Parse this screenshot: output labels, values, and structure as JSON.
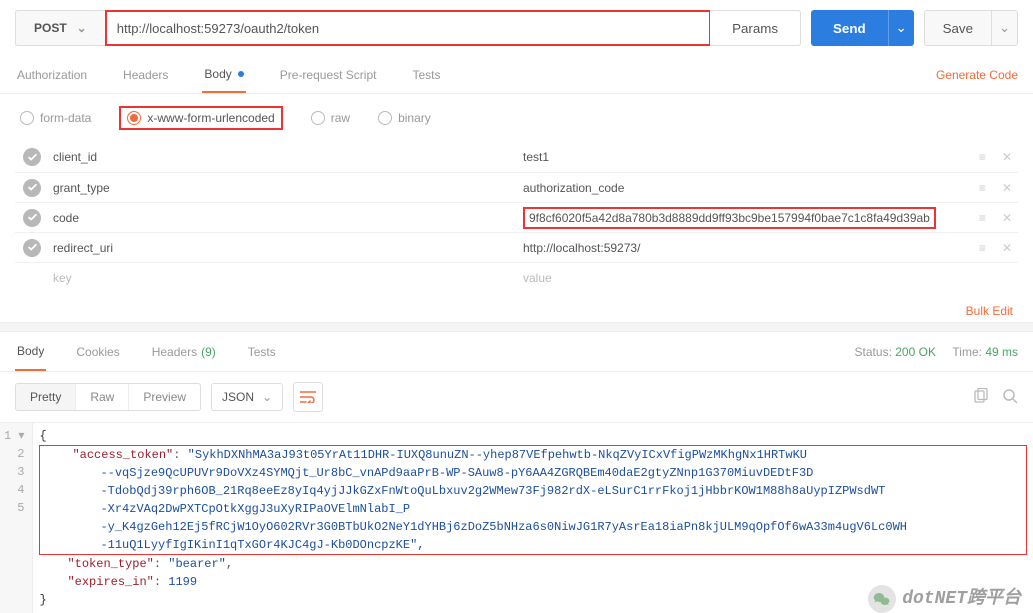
{
  "request": {
    "method": "POST",
    "url": "http://localhost:59273/oauth2/token",
    "params_btn": "Params",
    "send": "Send",
    "save": "Save"
  },
  "tabs": {
    "authorization": "Authorization",
    "headers": "Headers",
    "body": "Body",
    "prerequest": "Pre-request Script",
    "tests": "Tests",
    "generate_code": "Generate Code"
  },
  "body_types": {
    "formdata": "form-data",
    "urlencoded": "x-www-form-urlencoded",
    "raw": "raw",
    "binary": "binary"
  },
  "form": {
    "rows": [
      {
        "key": "client_id",
        "value": "test1",
        "boxed": false
      },
      {
        "key": "grant_type",
        "value": "authorization_code",
        "boxed": false
      },
      {
        "key": "code",
        "value": "9f8cf6020f5a42d8a780b3d8889dd9ff93bc9be157994f0bae7c1c8fa49d39ab",
        "boxed": true
      },
      {
        "key": "redirect_uri",
        "value": "http://localhost:59273/",
        "boxed": false
      }
    ],
    "key_ph": "key",
    "value_ph": "value",
    "bulk_edit": "Bulk Edit"
  },
  "response_tabs": {
    "body": "Body",
    "cookies": "Cookies",
    "headers": "Headers",
    "header_count": "(9)",
    "tests": "Tests",
    "status_label": "Status:",
    "status_value": "200 OK",
    "time_label": "Time:",
    "time_value": "49 ms"
  },
  "viewer": {
    "pretty": "Pretty",
    "raw": "Raw",
    "preview": "Preview",
    "format": "JSON"
  },
  "json_body": {
    "access_token_key": "\"access_token\"",
    "access_token_lines": [
      "\"SykhDXNhMA3aJ93t05YrAt11DHR-IUXQ8unuZN--yhep87VEfpehwtb-NkqZVyICxVfigPWzMKhgNx1HRTwKU",
      "--vqSjze9QcUPUVr9DoVXz4SYMQjt_Ur8bC_vnAPd9aaPrB-WP-SAuw8-pY6AA4ZGRQBEm40daE2gtyZNnp1G370MiuvDEDtF3D",
      "-TdobQdj39rph6OB_21Rq8eeEz8yIq4yjJJkGZxFnWtoQuLbxuv2g2WMew73Fj982rdX-eLSurC1rrFkoj1jHbbrKOW1M88h8aUypIZPWsdWT",
      "-Xr4zVAq2DwPXTCpOtkXggJ3uXyRIPaOVElmNlabI_P",
      "-y_K4gzGeh12Ej5fRCjW1OyO602RVr3G0BTbUkO2NeY1dYHBj6zDoZ5bNHza6s0NiwJG1R7yAsrEa18iaPn8kjULM9qOpfOf6wA33m4ugV6Lc0WH",
      "-11uQ1LyyfIgIKinI1qTxGOr4KJC4gJ-Kb0DOncpzKE\","
    ],
    "token_type_key": "\"token_type\"",
    "token_type_val": "\"bearer\"",
    "expires_key": "\"expires_in\"",
    "expires_val": "1199"
  },
  "watermark": "dotNET跨平台"
}
